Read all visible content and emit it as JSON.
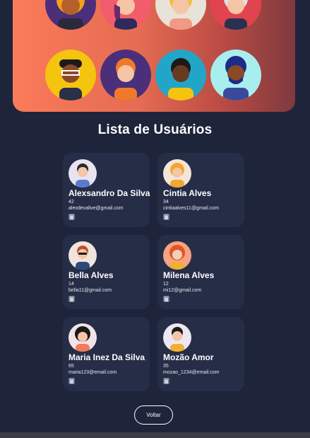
{
  "page": {
    "title": "Lista de Usuários",
    "back_label": "Voltar"
  },
  "colors": {
    "background": "#1e2439",
    "card": "#262d47",
    "hero_gradient_start": "#fb7b59",
    "hero_gradient_end": "#7e3a3f"
  },
  "hero": {
    "avatars": [
      {
        "icon": "person-curly-hair-avatar-icon"
      },
      {
        "icon": "person-teal-cap-avatar-icon"
      },
      {
        "icon": "person-blonde-avatar-icon"
      },
      {
        "icon": "person-gray-hair-avatar-icon"
      },
      {
        "icon": "person-glasses-avatar-icon"
      },
      {
        "icon": "person-ginger-avatar-icon"
      },
      {
        "icon": "person-headphones-avatar-icon"
      },
      {
        "icon": "person-beard-avatar-icon"
      }
    ]
  },
  "users": [
    {
      "name": "Alexsandro Da Silva",
      "age": "42",
      "email": "alexdevalive@gmail.com",
      "icon": "user-avatar-icon"
    },
    {
      "name": "Cintia Alves",
      "age": "34",
      "email": "cintiaalves11@gmail.com",
      "icon": "user-avatar-icon"
    },
    {
      "name": "Bella Alves",
      "age": "14",
      "email": "bella11@gmail.com",
      "icon": "user-avatar-icon"
    },
    {
      "name": "Milena Alves",
      "age": "12",
      "email": "mi12@gmail.com",
      "icon": "user-avatar-icon"
    },
    {
      "name": "Maria Inez Da Silva",
      "age": "65",
      "email": "maria123@email.com",
      "icon": "user-avatar-icon"
    },
    {
      "name": "Mozão Amor",
      "age": "35",
      "email": "mozao_1234@email.com",
      "icon": "user-avatar-icon"
    }
  ]
}
